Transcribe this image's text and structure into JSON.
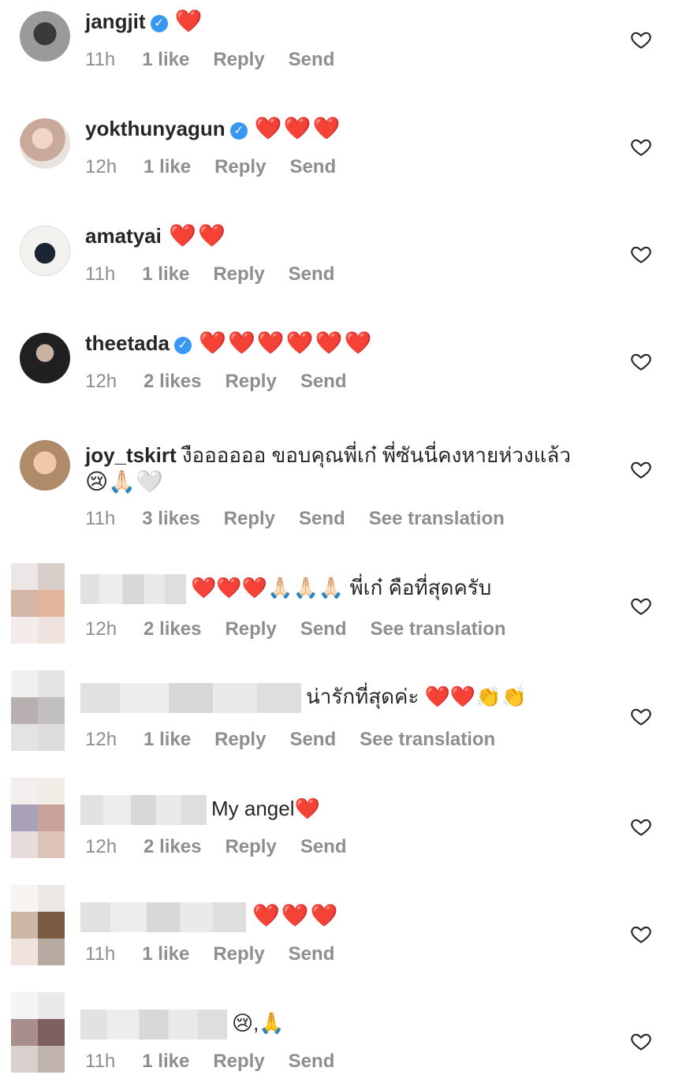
{
  "comments": [
    {
      "user": "jangjit",
      "verified": true,
      "text": "❤️",
      "time": "11h",
      "likes": "1 like",
      "reply": "Reply",
      "send": "Send",
      "translation": ""
    },
    {
      "user": "yokthunyagun",
      "verified": true,
      "text": "❤️❤️❤️",
      "time": "12h",
      "likes": "1 like",
      "reply": "Reply",
      "send": "Send",
      "translation": ""
    },
    {
      "user": "amatyai",
      "verified": false,
      "text": "❤️❤️",
      "time": "11h",
      "likes": "1 like",
      "reply": "Reply",
      "send": "Send",
      "translation": ""
    },
    {
      "user": "theetada",
      "verified": true,
      "text": "❤️❤️❤️❤️❤️❤️",
      "time": "12h",
      "likes": "2 likes",
      "reply": "Reply",
      "send": "Send",
      "translation": ""
    },
    {
      "user": "joy_tskirt",
      "verified": false,
      "text": "งืออออออ ขอบคุณพี่เก๋ พี่ซันนี่คงหายห่วงแล้ว",
      "text2": "😢🙏🏻🤍",
      "time": "11h",
      "likes": "3 likes",
      "reply": "Reply",
      "send": "Send",
      "translation": "See translation"
    },
    {
      "user": "",
      "verified": false,
      "text": "❤️❤️❤️🙏🏻🙏🏻🙏🏻 พี่เก๋ คือที่สุดครับ",
      "time": "12h",
      "likes": "2 likes",
      "reply": "Reply",
      "send": "Send",
      "translation": "See translation"
    },
    {
      "user": "",
      "verified": false,
      "text": "น่ารักที่สุดค่ะ ❤️❤️👏👏",
      "time": "12h",
      "likes": "1 like",
      "reply": "Reply",
      "send": "Send",
      "translation": "See translation"
    },
    {
      "user": "",
      "verified": false,
      "text": "My angel❤️",
      "time": "12h",
      "likes": "2 likes",
      "reply": "Reply",
      "send": "Send",
      "translation": ""
    },
    {
      "user": "",
      "verified": false,
      "text": "❤️❤️❤️",
      "time": "11h",
      "likes": "1 like",
      "reply": "Reply",
      "send": "Send",
      "translation": ""
    },
    {
      "user": "",
      "verified": false,
      "text": "😢,🙏",
      "time": "11h",
      "likes": "1 like",
      "reply": "Reply",
      "send": "Send",
      "translation": ""
    }
  ],
  "icons": {
    "verified": "verified-badge-icon",
    "like": "heart-outline-icon"
  },
  "colors": {
    "meta": "#8e8e8e",
    "verified": "#3897f0",
    "heart": "#e8202c"
  }
}
